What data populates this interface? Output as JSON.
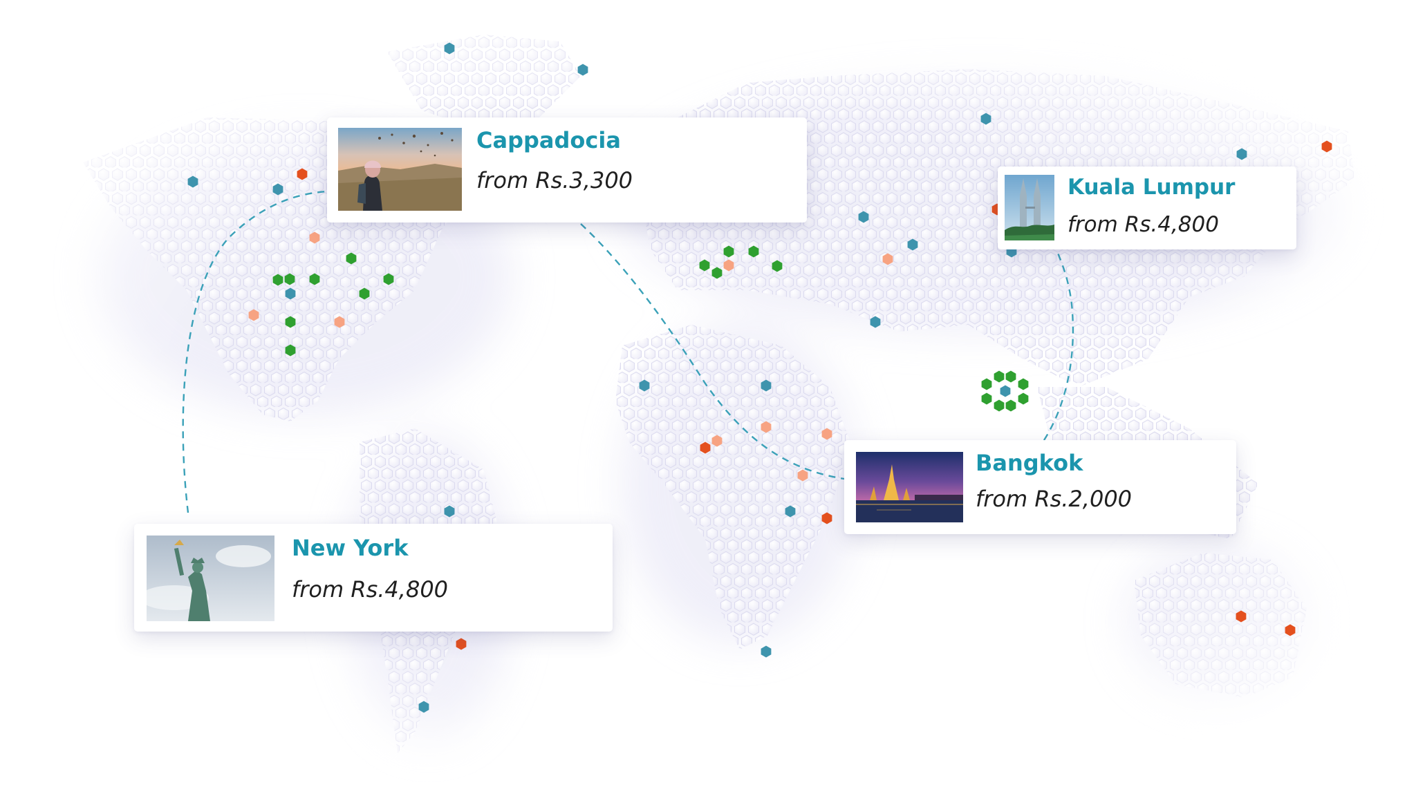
{
  "colors": {
    "accent": "#1b95ad",
    "route": "#3aa1b8",
    "marker_blue": "#3e94ad",
    "marker_orange_dark": "#e4501e",
    "marker_orange_light": "#f7a382",
    "marker_green": "#2fa030"
  },
  "destinations": [
    {
      "city": "Cappadocia",
      "price": "from Rs.3,300"
    },
    {
      "city": "Kuala Lumpur",
      "price": "from Rs.4,800"
    },
    {
      "city": "Bangkok",
      "price": "from Rs.2,000"
    },
    {
      "city": "New York",
      "price": "from Rs.4,800"
    }
  ]
}
